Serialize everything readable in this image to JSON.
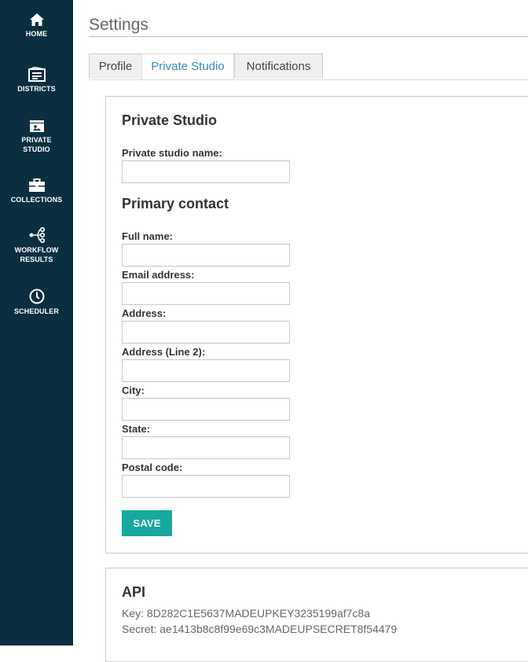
{
  "sidebar": {
    "items": [
      {
        "label": "HOME",
        "icon": "home-icon"
      },
      {
        "label": "DISTRICTS",
        "icon": "districts-icon"
      },
      {
        "label": "PRIVATE\nSTUDIO",
        "icon": "private-studio-icon"
      },
      {
        "label": "COLLECTIONS",
        "icon": "briefcase-icon"
      },
      {
        "label": "WORKFLOW\nRESULTS",
        "icon": "workflow-icon"
      },
      {
        "label": "SCHEDULER",
        "icon": "clock-icon"
      }
    ],
    "background": "#0b2e40"
  },
  "page": {
    "title": "Settings"
  },
  "tabs": [
    {
      "label": "Profile",
      "active": false
    },
    {
      "label": "Private Studio",
      "active": true
    },
    {
      "label": "Notifications",
      "active": false
    }
  ],
  "studio": {
    "heading": "Private Studio",
    "name_label": "Private studio name:",
    "name_value": ""
  },
  "contact": {
    "heading": "Primary contact",
    "full_name_label": "Full name:",
    "email_label": "Email address:",
    "address_label": "Address:",
    "address2_label": "Address (Line 2):",
    "city_label": "City:",
    "state_label": "State:",
    "postal_label": "Postal code:"
  },
  "save_label": "SAVE",
  "accent_color": "#17a89e",
  "api": {
    "heading": "API",
    "key_line": "Key: 8D282C1E5637MADEUPKEY3235199af7c8a",
    "secret_line": "Secret: ae1413b8c8f99e69c3MADEUPSECRET8f54479"
  }
}
